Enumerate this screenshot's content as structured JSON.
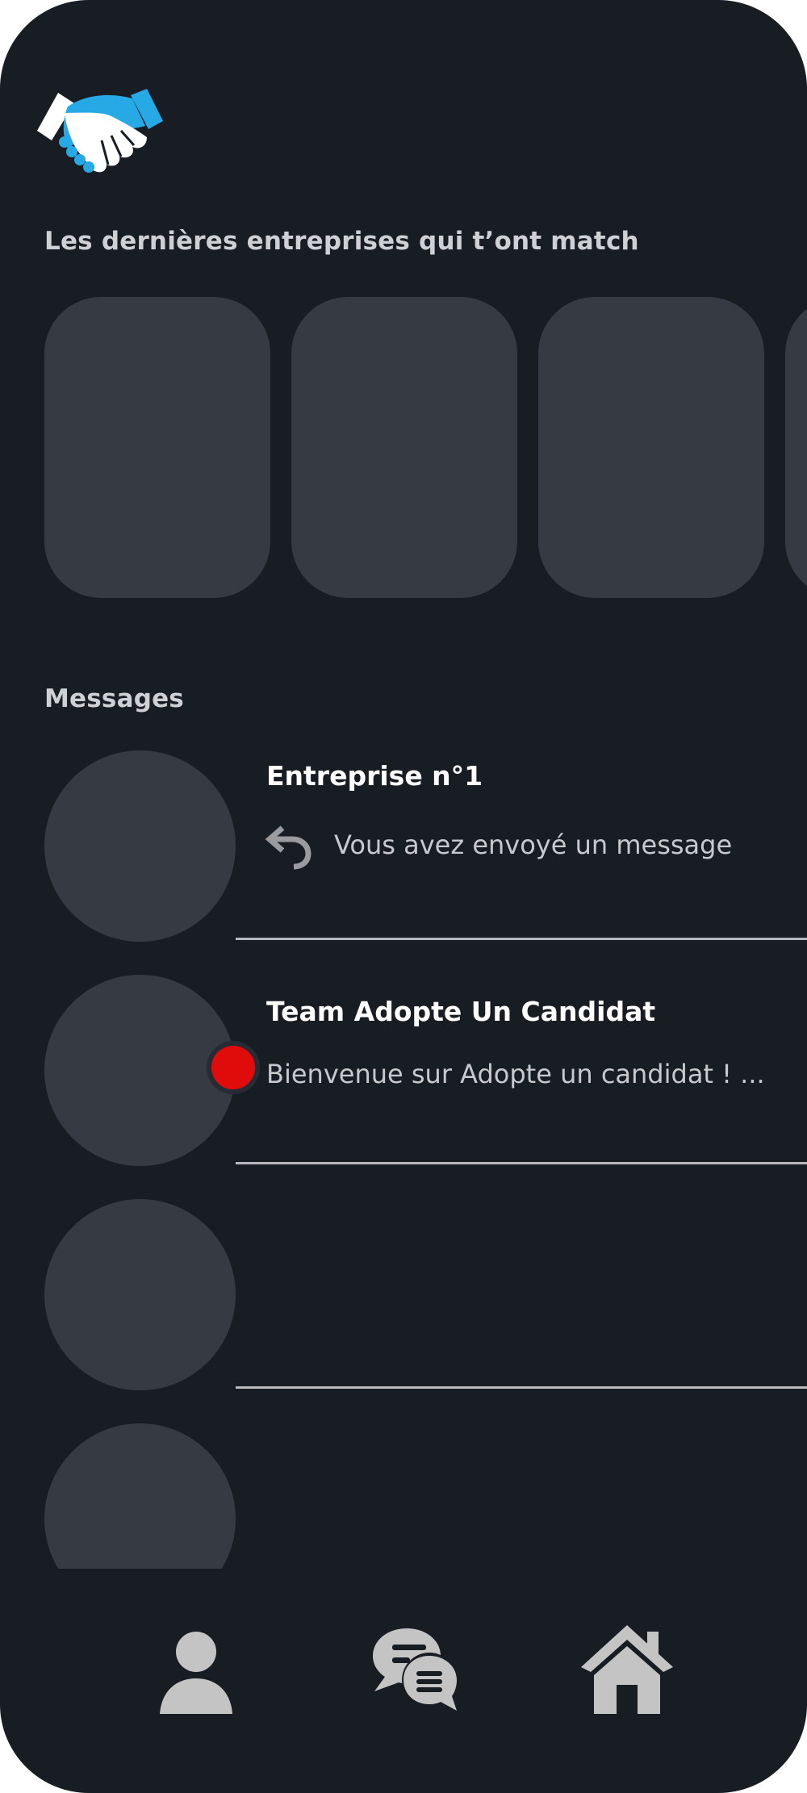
{
  "app": {
    "logo_icon": "handshake-icon",
    "logo_colors": {
      "accent": "#27a9e6",
      "hand": "#ffffff"
    }
  },
  "matches": {
    "title": "Les dernières entreprises qui t’ont match",
    "cards": [
      {},
      {},
      {},
      {}
    ]
  },
  "messages": {
    "title": "Messages",
    "conversations": [
      {
        "name": "Entreprise n°1",
        "preview": "Vous avez envoyé un message",
        "status_icon": "reply-icon",
        "unread": false
      },
      {
        "name": "Team Adopte Un Candidat",
        "preview": "Bienvenue sur Adopte un candidat ! ...",
        "unread": true
      },
      {
        "name": "",
        "preview": ""
      },
      {
        "name": "",
        "preview": ""
      }
    ]
  },
  "bottom_nav": {
    "items": [
      {
        "icon": "profile-icon"
      },
      {
        "icon": "chat-icon"
      },
      {
        "icon": "home-icon"
      }
    ]
  },
  "colors": {
    "background": "#181c23",
    "placeholder": "#363a43",
    "unread": "#e00c0c",
    "icon": "#c4c4c4"
  }
}
